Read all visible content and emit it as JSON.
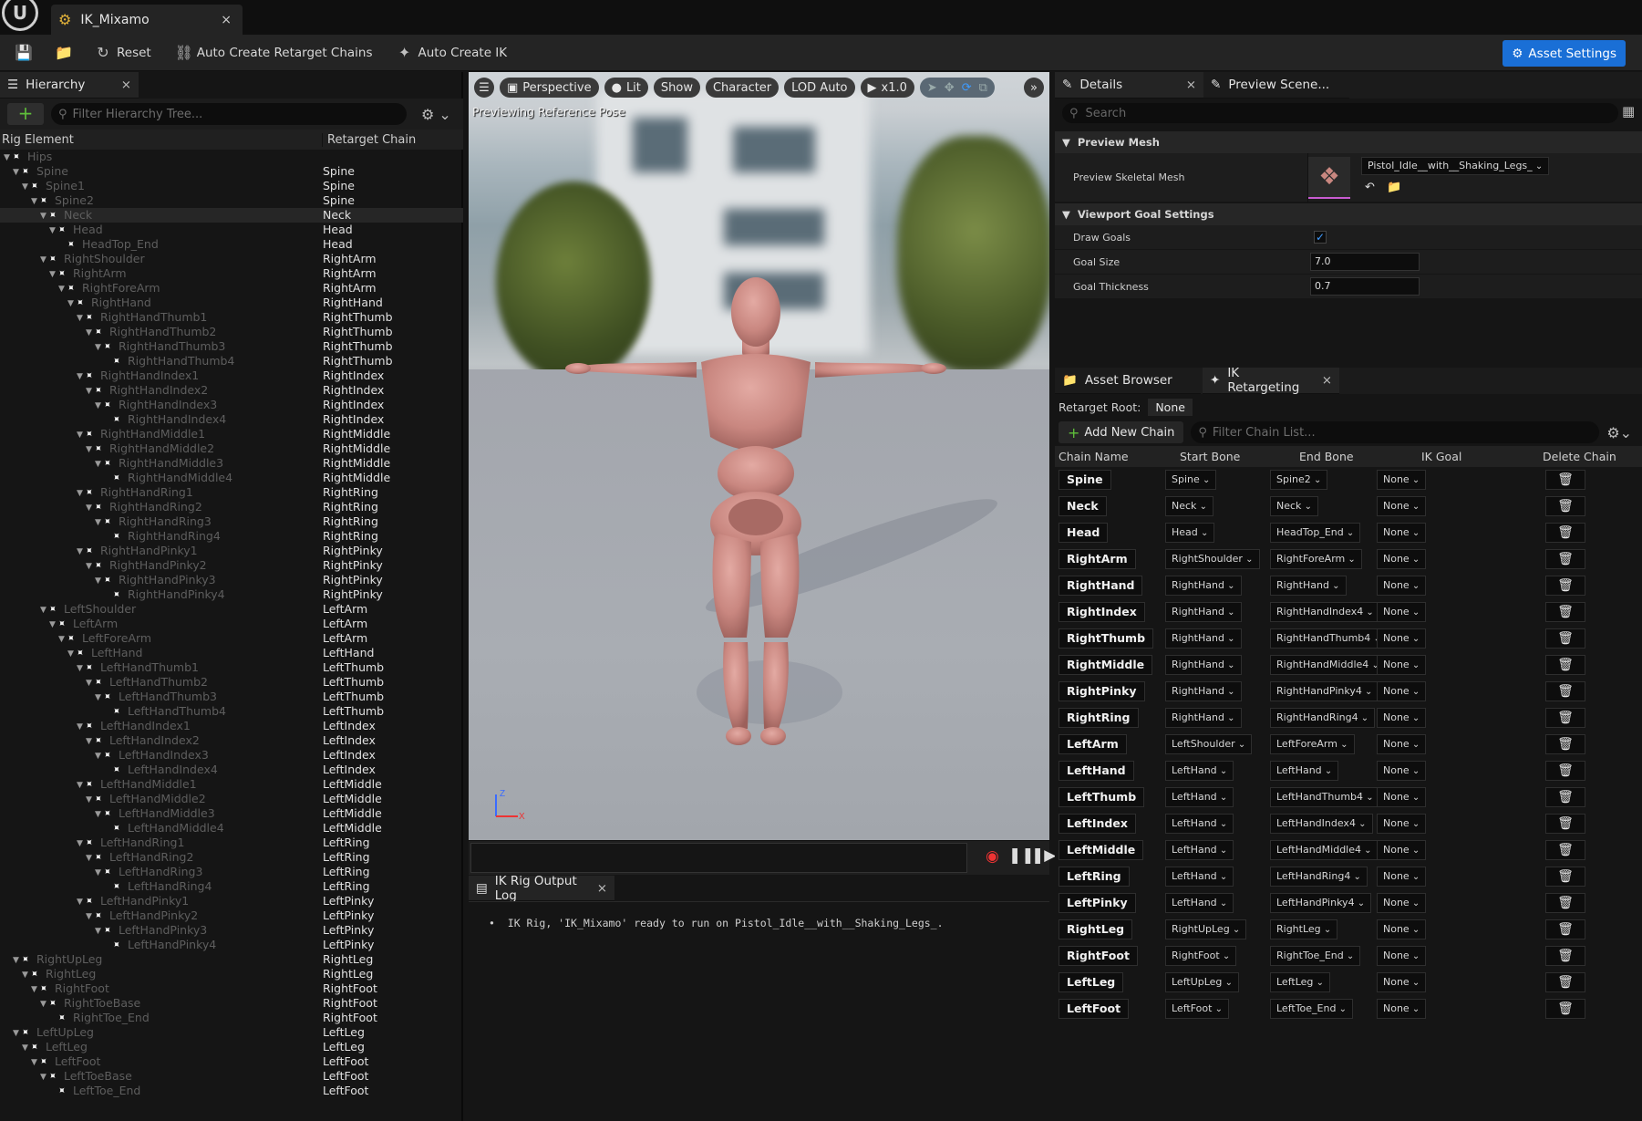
{
  "window": {
    "tab_title": "IK_Mixamo",
    "tab_close": "×"
  },
  "toolbar": {
    "reset": "Reset",
    "auto_chains": "Auto Create Retarget Chains",
    "auto_ik": "Auto Create IK",
    "asset_settings": "Asset Settings"
  },
  "hierarchy": {
    "tab_label": "Hierarchy",
    "search_placeholder": "Filter Hierarchy Tree...",
    "col_rig": "Rig Element",
    "col_chain": "Retarget Chain",
    "rows": [
      {
        "name": "Hips",
        "depth": 0,
        "chain": ""
      },
      {
        "name": "Spine",
        "depth": 1,
        "chain": "Spine"
      },
      {
        "name": "Spine1",
        "depth": 2,
        "chain": "Spine"
      },
      {
        "name": "Spine2",
        "depth": 3,
        "chain": "Spine"
      },
      {
        "name": "Neck",
        "depth": 4,
        "chain": "Neck"
      },
      {
        "name": "Head",
        "depth": 5,
        "chain": "Head"
      },
      {
        "name": "HeadTop_End",
        "depth": 6,
        "chain": "Head"
      },
      {
        "name": "RightShoulder",
        "depth": 4,
        "chain": "RightArm"
      },
      {
        "name": "RightArm",
        "depth": 5,
        "chain": "RightArm"
      },
      {
        "name": "RightForeArm",
        "depth": 6,
        "chain": "RightArm"
      },
      {
        "name": "RightHand",
        "depth": 7,
        "chain": "RightHand"
      },
      {
        "name": "RightHandThumb1",
        "depth": 8,
        "chain": "RightThumb"
      },
      {
        "name": "RightHandThumb2",
        "depth": 9,
        "chain": "RightThumb"
      },
      {
        "name": "RightHandThumb3",
        "depth": 10,
        "chain": "RightThumb"
      },
      {
        "name": "RightHandThumb4",
        "depth": 11,
        "chain": "RightThumb"
      },
      {
        "name": "RightHandIndex1",
        "depth": 8,
        "chain": "RightIndex"
      },
      {
        "name": "RightHandIndex2",
        "depth": 9,
        "chain": "RightIndex"
      },
      {
        "name": "RightHandIndex3",
        "depth": 10,
        "chain": "RightIndex"
      },
      {
        "name": "RightHandIndex4",
        "depth": 11,
        "chain": "RightIndex"
      },
      {
        "name": "RightHandMiddle1",
        "depth": 8,
        "chain": "RightMiddle"
      },
      {
        "name": "RightHandMiddle2",
        "depth": 9,
        "chain": "RightMiddle"
      },
      {
        "name": "RightHandMiddle3",
        "depth": 10,
        "chain": "RightMiddle"
      },
      {
        "name": "RightHandMiddle4",
        "depth": 11,
        "chain": "RightMiddle"
      },
      {
        "name": "RightHandRing1",
        "depth": 8,
        "chain": "RightRing"
      },
      {
        "name": "RightHandRing2",
        "depth": 9,
        "chain": "RightRing"
      },
      {
        "name": "RightHandRing3",
        "depth": 10,
        "chain": "RightRing"
      },
      {
        "name": "RightHandRing4",
        "depth": 11,
        "chain": "RightRing"
      },
      {
        "name": "RightHandPinky1",
        "depth": 8,
        "chain": "RightPinky"
      },
      {
        "name": "RightHandPinky2",
        "depth": 9,
        "chain": "RightPinky"
      },
      {
        "name": "RightHandPinky3",
        "depth": 10,
        "chain": "RightPinky"
      },
      {
        "name": "RightHandPinky4",
        "depth": 11,
        "chain": "RightPinky"
      },
      {
        "name": "LeftShoulder",
        "depth": 4,
        "chain": "LeftArm"
      },
      {
        "name": "LeftArm",
        "depth": 5,
        "chain": "LeftArm"
      },
      {
        "name": "LeftForeArm",
        "depth": 6,
        "chain": "LeftArm"
      },
      {
        "name": "LeftHand",
        "depth": 7,
        "chain": "LeftHand"
      },
      {
        "name": "LeftHandThumb1",
        "depth": 8,
        "chain": "LeftThumb"
      },
      {
        "name": "LeftHandThumb2",
        "depth": 9,
        "chain": "LeftThumb"
      },
      {
        "name": "LeftHandThumb3",
        "depth": 10,
        "chain": "LeftThumb"
      },
      {
        "name": "LeftHandThumb4",
        "depth": 11,
        "chain": "LeftThumb"
      },
      {
        "name": "LeftHandIndex1",
        "depth": 8,
        "chain": "LeftIndex"
      },
      {
        "name": "LeftHandIndex2",
        "depth": 9,
        "chain": "LeftIndex"
      },
      {
        "name": "LeftHandIndex3",
        "depth": 10,
        "chain": "LeftIndex"
      },
      {
        "name": "LeftHandIndex4",
        "depth": 11,
        "chain": "LeftIndex"
      },
      {
        "name": "LeftHandMiddle1",
        "depth": 8,
        "chain": "LeftMiddle"
      },
      {
        "name": "LeftHandMiddle2",
        "depth": 9,
        "chain": "LeftMiddle"
      },
      {
        "name": "LeftHandMiddle3",
        "depth": 10,
        "chain": "LeftMiddle"
      },
      {
        "name": "LeftHandMiddle4",
        "depth": 11,
        "chain": "LeftMiddle"
      },
      {
        "name": "LeftHandRing1",
        "depth": 8,
        "chain": "LeftRing"
      },
      {
        "name": "LeftHandRing2",
        "depth": 9,
        "chain": "LeftRing"
      },
      {
        "name": "LeftHandRing3",
        "depth": 10,
        "chain": "LeftRing"
      },
      {
        "name": "LeftHandRing4",
        "depth": 11,
        "chain": "LeftRing"
      },
      {
        "name": "LeftHandPinky1",
        "depth": 8,
        "chain": "LeftPinky"
      },
      {
        "name": "LeftHandPinky2",
        "depth": 9,
        "chain": "LeftPinky"
      },
      {
        "name": "LeftHandPinky3",
        "depth": 10,
        "chain": "LeftPinky"
      },
      {
        "name": "LeftHandPinky4",
        "depth": 11,
        "chain": "LeftPinky"
      },
      {
        "name": "RightUpLeg",
        "depth": 1,
        "chain": "RightLeg"
      },
      {
        "name": "RightLeg",
        "depth": 2,
        "chain": "RightLeg"
      },
      {
        "name": "RightFoot",
        "depth": 3,
        "chain": "RightFoot"
      },
      {
        "name": "RightToeBase",
        "depth": 4,
        "chain": "RightFoot"
      },
      {
        "name": "RightToe_End",
        "depth": 5,
        "chain": "RightFoot"
      },
      {
        "name": "LeftUpLeg",
        "depth": 1,
        "chain": "LeftLeg"
      },
      {
        "name": "LeftLeg",
        "depth": 2,
        "chain": "LeftLeg"
      },
      {
        "name": "LeftFoot",
        "depth": 3,
        "chain": "LeftFoot"
      },
      {
        "name": "LeftToeBase",
        "depth": 4,
        "chain": "LeftFoot"
      },
      {
        "name": "LeftToe_End",
        "depth": 5,
        "chain": "LeftFoot"
      }
    ]
  },
  "viewport": {
    "perspective": "Perspective",
    "lit": "Lit",
    "show": "Show",
    "character": "Character",
    "lod": "LOD Auto",
    "speed": "x1.0",
    "status": "Previewing Reference Pose",
    "axis_z": "Z",
    "axis_x": "X"
  },
  "log": {
    "tab_label": "IK Rig Output Log",
    "line": "IK Rig, 'IK_Mixamo' ready to run on Pistol_Idle__with__Shaking_Legs_."
  },
  "details": {
    "tab_label": "Details",
    "preview_tab": "Preview Scene...",
    "search_placeholder": "Search",
    "section_mesh": "Preview Mesh",
    "skeletal_mesh_label": "Preview Skeletal Mesh",
    "skeletal_mesh_value": "Pistol_Idle__with__Shaking_Legs_",
    "section_goal": "Viewport Goal Settings",
    "draw_goals": "Draw Goals",
    "goal_size_label": "Goal Size",
    "goal_size": "7.0",
    "goal_thickness_label": "Goal Thickness",
    "goal_thickness": "0.7"
  },
  "retarget": {
    "asset_browser_tab": "Asset Browser",
    "tab_label": "IK Retargeting",
    "root_label": "Retarget Root:",
    "root_value": "None",
    "add_chain": "Add New Chain",
    "filter_placeholder": "Filter Chain List...",
    "col_name": "Chain Name",
    "col_start": "Start Bone",
    "col_end": "End Bone",
    "col_goal": "IK Goal",
    "col_delete": "Delete Chain",
    "chains": [
      {
        "name": "Spine",
        "start": "Spine",
        "end": "Spine2",
        "goal": "None"
      },
      {
        "name": "Neck",
        "start": "Neck",
        "end": "Neck",
        "goal": "None"
      },
      {
        "name": "Head",
        "start": "Head",
        "end": "HeadTop_End",
        "goal": "None"
      },
      {
        "name": "RightArm",
        "start": "RightShoulder",
        "end": "RightForeArm",
        "goal": "None"
      },
      {
        "name": "RightHand",
        "start": "RightHand",
        "end": "RightHand",
        "goal": "None"
      },
      {
        "name": "RightIndex",
        "start": "RightHand",
        "end": "RightHandIndex4",
        "goal": "None"
      },
      {
        "name": "RightThumb",
        "start": "RightHand",
        "end": "RightHandThumb4",
        "goal": "None"
      },
      {
        "name": "RightMiddle",
        "start": "RightHand",
        "end": "RightHandMiddle4",
        "goal": "None"
      },
      {
        "name": "RightPinky",
        "start": "RightHand",
        "end": "RightHandPinky4",
        "goal": "None"
      },
      {
        "name": "RightRing",
        "start": "RightHand",
        "end": "RightHandRing4",
        "goal": "None"
      },
      {
        "name": "LeftArm",
        "start": "LeftShoulder",
        "end": "LeftForeArm",
        "goal": "None"
      },
      {
        "name": "LeftHand",
        "start": "LeftHand",
        "end": "LeftHand",
        "goal": "None"
      },
      {
        "name": "LeftThumb",
        "start": "LeftHand",
        "end": "LeftHandThumb4",
        "goal": "None"
      },
      {
        "name": "LeftIndex",
        "start": "LeftHand",
        "end": "LeftHandIndex4",
        "goal": "None"
      },
      {
        "name": "LeftMiddle",
        "start": "LeftHand",
        "end": "LeftHandMiddle4",
        "goal": "None"
      },
      {
        "name": "LeftRing",
        "start": "LeftHand",
        "end": "LeftHandRing4",
        "goal": "None"
      },
      {
        "name": "LeftPinky",
        "start": "LeftHand",
        "end": "LeftHandPinky4",
        "goal": "None"
      },
      {
        "name": "RightLeg",
        "start": "RightUpLeg",
        "end": "RightLeg",
        "goal": "None"
      },
      {
        "name": "RightFoot",
        "start": "RightFoot",
        "end": "RightToe_End",
        "goal": "None"
      },
      {
        "name": "LeftLeg",
        "start": "LeftUpLeg",
        "end": "LeftLeg",
        "goal": "None"
      },
      {
        "name": "LeftFoot",
        "start": "LeftFoot",
        "end": "LeftToe_End",
        "goal": "None"
      }
    ]
  }
}
